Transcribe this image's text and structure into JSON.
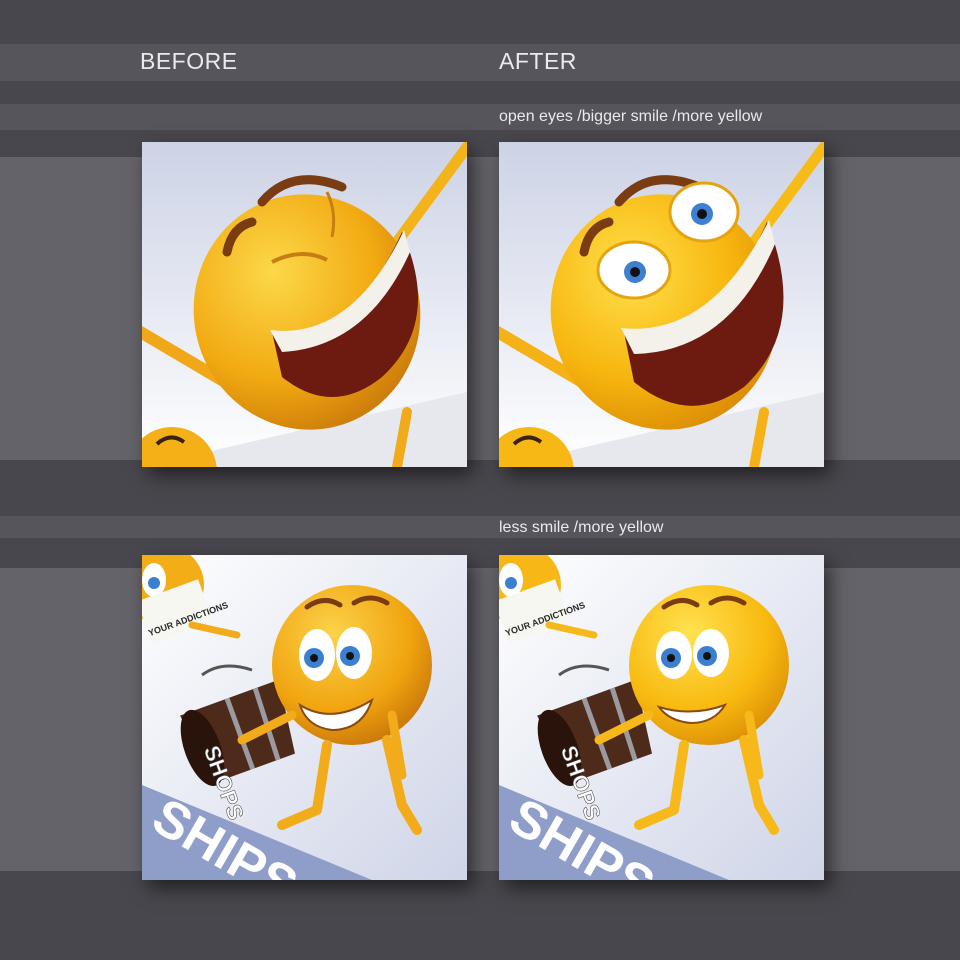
{
  "headings": {
    "before": "BEFORE",
    "after": "AFTER"
  },
  "rows": [
    {
      "caption": "open eyes /bigger smile /more yellow"
    },
    {
      "caption": "less smile /more yellow"
    }
  ],
  "artwork_text": {
    "book_title": "YOUR ADDICTIONS",
    "floor_text": "SHIPS",
    "spill_text": "SHOPS"
  },
  "colors": {
    "background": "#48474d",
    "band": "#5c5b62",
    "wide_band": "#66656b",
    "emoji_yellow": "#f5b60f",
    "text": "#e9e9ee"
  }
}
